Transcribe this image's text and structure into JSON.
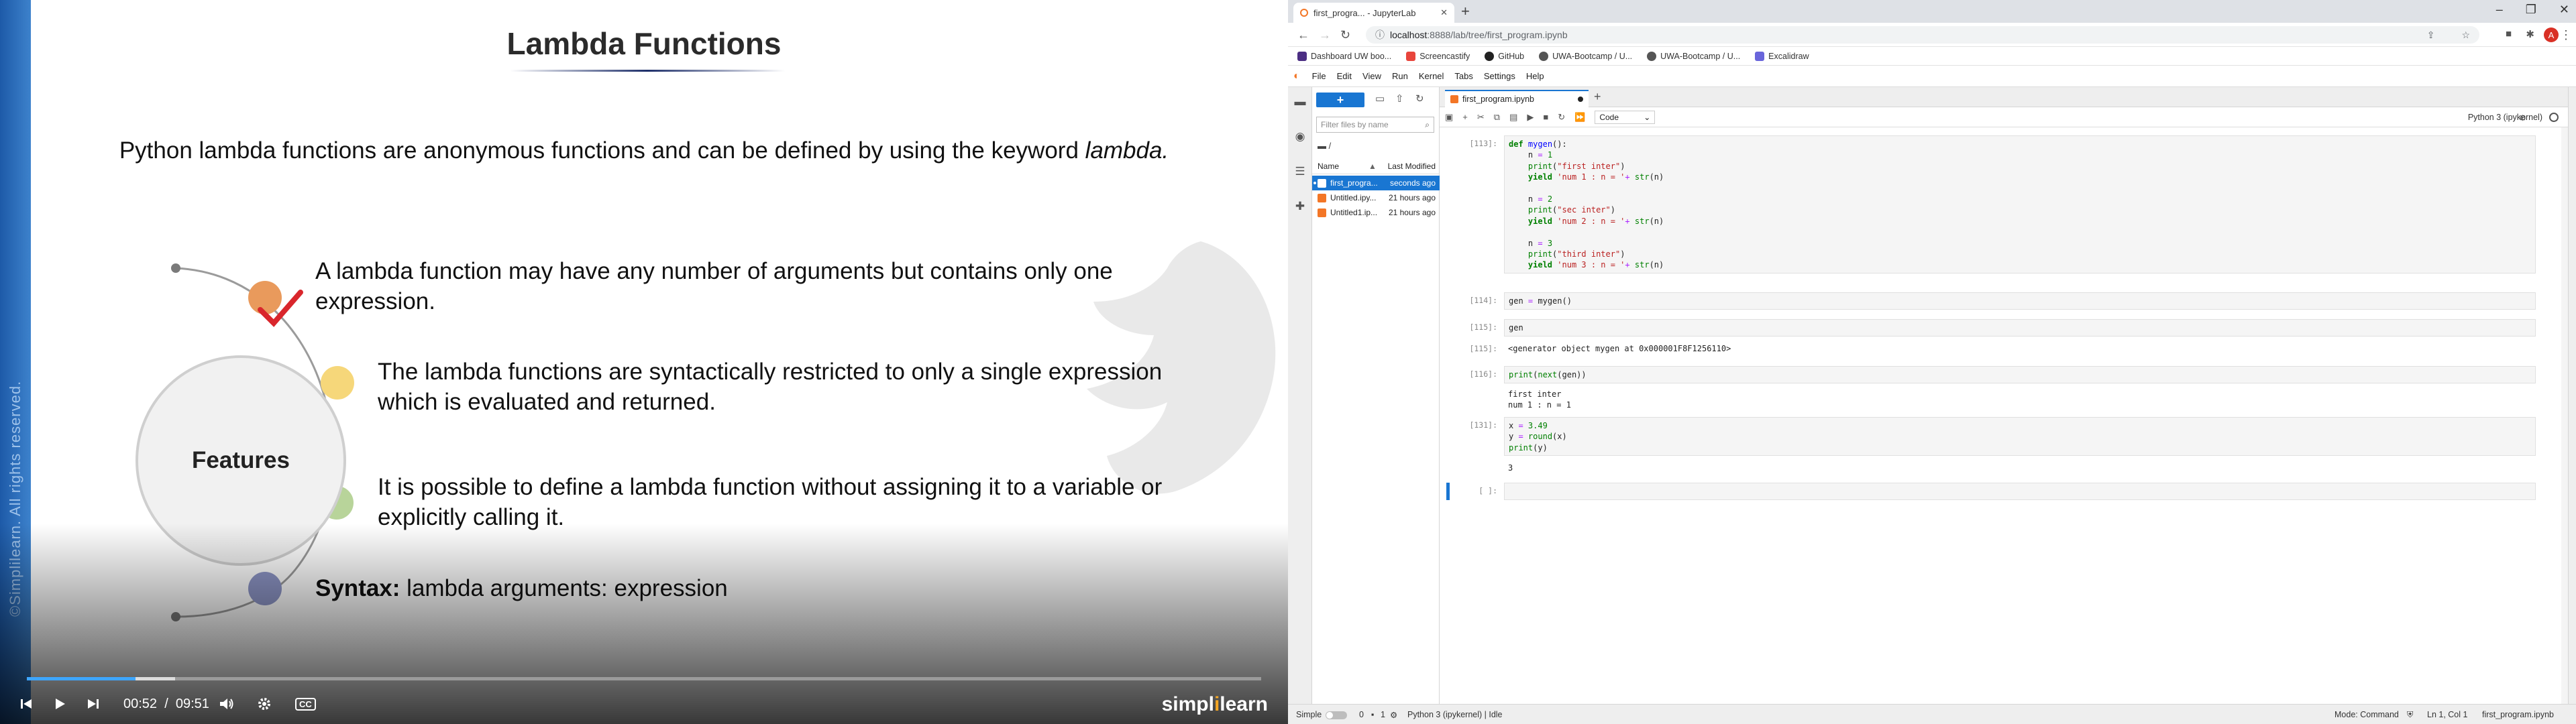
{
  "slide": {
    "title": "Lambda Functions",
    "intro_prefix": "Python lambda functions are anonymous functions and can be defined by using the keyword ",
    "intro_keyword": "lambda.",
    "center_label": "Features",
    "bullets": [
      "A lambda function may have any number of arguments but contains only one expression.",
      "The lambda functions are syntactically restricted to only a single expression which is evaluated and returned.",
      "It is possible to define a lambda function without assigning it to a variable or explicitly calling it."
    ],
    "syntax_label": "Syntax:",
    "syntax_text": " lambda arguments: expression",
    "dot_colors": [
      "#e99a5c",
      "#f6d77a",
      "#b8d49a",
      "#8d95c6"
    ],
    "watermark": "©Simplilearn. All rights reserved."
  },
  "player": {
    "current_time": "00:52",
    "separator": "/",
    "duration": "09:51",
    "progress_fraction": 0.088,
    "brand_prefix": "simpl",
    "brand_o": "i",
    "brand_suffix": "learn",
    "cc_label": "CC",
    "accent": "#3ea6ff"
  },
  "browser": {
    "tab_title": "first_progra... - JupyterLab",
    "url_host": "localhost",
    "url_path": ":8888/lab/tree/first_program.ipynb",
    "profile_initial": "A",
    "bookmarks": [
      {
        "label": "Dashboard UW boo...",
        "color": "#4b2e83"
      },
      {
        "label": "Screencastify",
        "color": "#e8453c"
      },
      {
        "label": "GitHub",
        "color": "#222222"
      },
      {
        "label": "UWA-Bootcamp / U...",
        "color": "#555555"
      },
      {
        "label": "UWA-Bootcamp / U...",
        "color": "#555555"
      },
      {
        "label": "Excalidraw",
        "color": "#6965db"
      }
    ]
  },
  "jupyter": {
    "menu": [
      "File",
      "Edit",
      "View",
      "Run",
      "Kernel",
      "Tabs",
      "Settings",
      "Help"
    ],
    "filter_placeholder": "Filter files by name",
    "breadcrumb": "/",
    "col_name": "Name",
    "col_modified": "Last Modified",
    "files": [
      {
        "name": "first_progra...",
        "modified": "seconds ago",
        "selected": true
      },
      {
        "name": "Untitled.ipy...",
        "modified": "21 hours ago",
        "selected": false
      },
      {
        "name": "Untitled1.ip...",
        "modified": "21 hours ago",
        "selected": false
      }
    ],
    "notebook_tab": "first_program.ipynb",
    "cell_type": "Code",
    "kernel": "Python 3 (ipykernel)",
    "cells": [
      {
        "prompt": "[113]:",
        "code": "def mygen():\n    n = 1\n    print(\"first inter\")\n    yield 'num 1 : n = '+ str(n)\n\n    n = 2\n    print(\"sec inter\")\n    yield 'num 2 : n = '+ str(n)\n\n    n = 3\n    print(\"third inter\")\n    yield 'num 3 : n = '+ str(n)"
      },
      {
        "prompt": "[114]:",
        "code": "gen = mygen()"
      },
      {
        "prompt": "[115]:",
        "code": "gen"
      },
      {
        "prompt": "[115]:",
        "output": "<generator object mygen at 0x000001F8F1256110>"
      },
      {
        "prompt": "[116]:",
        "code": "print(next(gen))"
      },
      {
        "output": "first inter\nnum 1 : n = 1"
      },
      {
        "prompt": "[131]:",
        "code": "x = 3.49\ny = round(x)\nprint(y)"
      },
      {
        "output": "3"
      },
      {
        "prompt": "[ ]:",
        "code": ""
      }
    ],
    "status": {
      "mode_label": "Simple",
      "zero": "0",
      "one": "1",
      "kernel_state": "Python 3 (ipykernel) | Idle",
      "mode": "Mode: Command",
      "position": "Ln 1, Col 1",
      "file": "first_program.ipynb"
    }
  }
}
